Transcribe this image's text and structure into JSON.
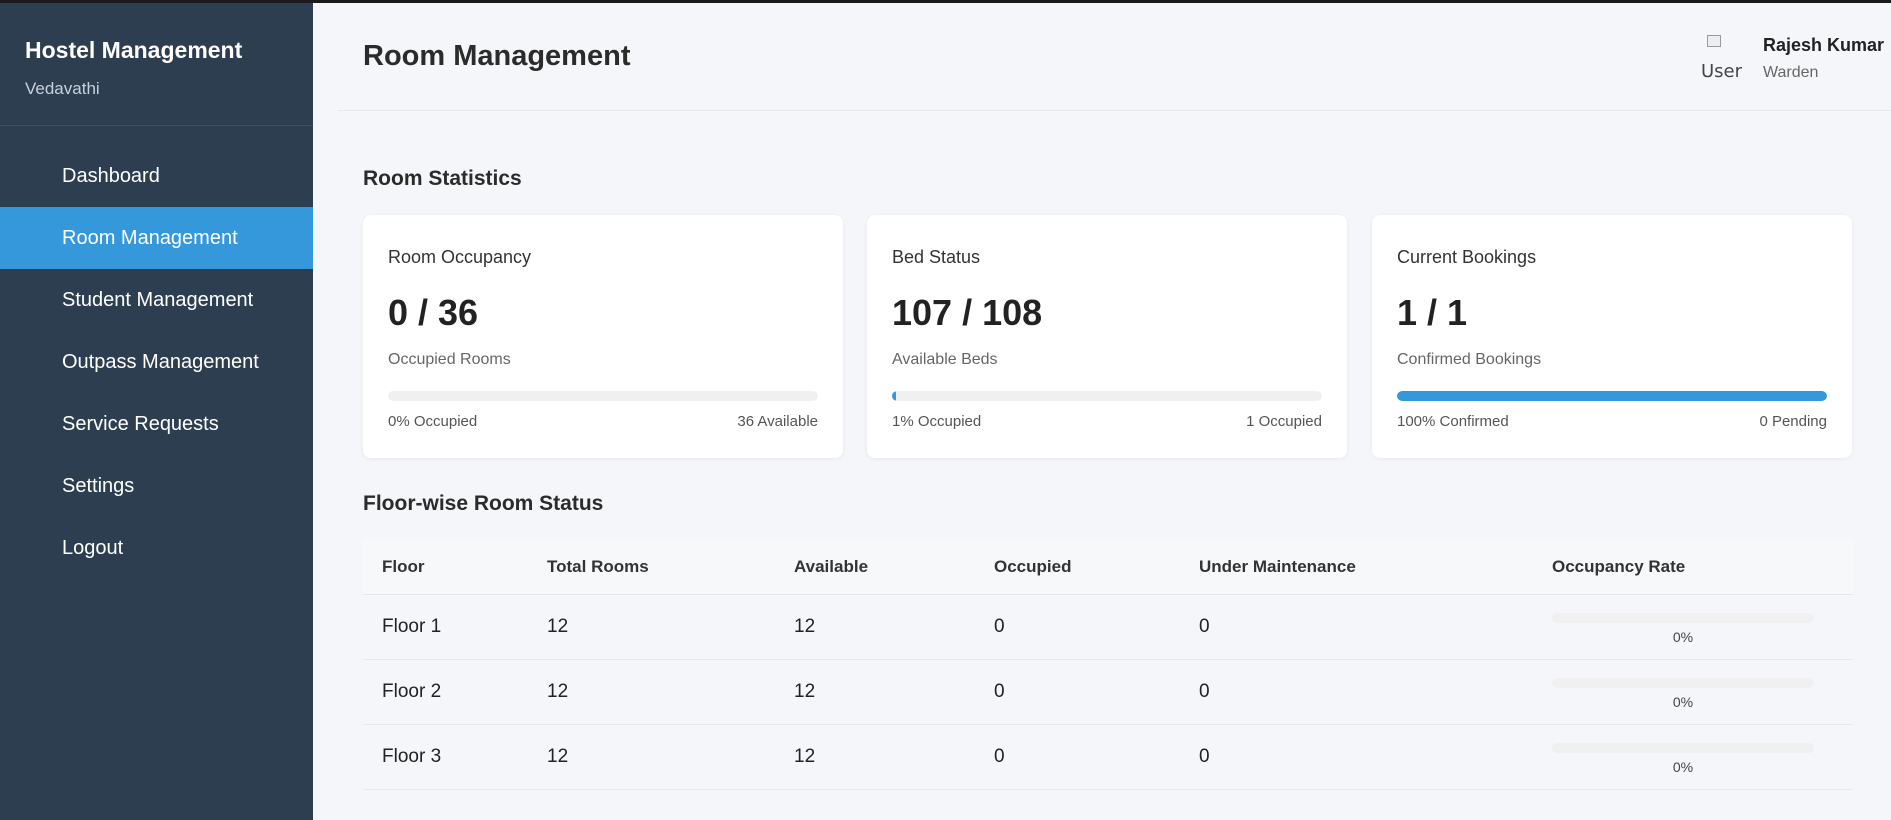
{
  "sidebar": {
    "title": "Hostel Management",
    "subtitle": "Vedavathi",
    "items": [
      {
        "label": "Dashboard",
        "active": false
      },
      {
        "label": "Room Management",
        "active": true
      },
      {
        "label": "Student Management",
        "active": false
      },
      {
        "label": "Outpass Management",
        "active": false
      },
      {
        "label": "Service Requests",
        "active": false
      },
      {
        "label": "Settings",
        "active": false
      },
      {
        "label": "Logout",
        "active": false
      }
    ]
  },
  "header": {
    "title": "Room Management",
    "user": {
      "avatar_alt": "User",
      "name": "Rajesh Kumar",
      "role": "Warden"
    }
  },
  "stats": {
    "section_title": "Room Statistics",
    "cards": [
      {
        "title": "Room Occupancy",
        "value": "0 / 36",
        "sub": "Occupied Rooms",
        "progress": 0,
        "left": "0% Occupied",
        "right": "36 Available"
      },
      {
        "title": "Bed Status",
        "value": "107 / 108",
        "sub": "Available Beds",
        "progress": 1,
        "left": "1% Occupied",
        "right": "1 Occupied"
      },
      {
        "title": "Current Bookings",
        "value": "1 / 1",
        "sub": "Confirmed Bookings",
        "progress": 100,
        "left": "100% Confirmed",
        "right": "0 Pending"
      }
    ]
  },
  "floors": {
    "section_title": "Floor-wise Room Status",
    "columns": [
      "Floor",
      "Total Rooms",
      "Available",
      "Occupied",
      "Under Maintenance",
      "Occupancy Rate"
    ],
    "rows": [
      {
        "floor": "Floor 1",
        "total": "12",
        "available": "12",
        "occupied": "0",
        "maintenance": "0",
        "rate": 0,
        "rate_label": "0%"
      },
      {
        "floor": "Floor 2",
        "total": "12",
        "available": "12",
        "occupied": "0",
        "maintenance": "0",
        "rate": 0,
        "rate_label": "0%"
      },
      {
        "floor": "Floor 3",
        "total": "12",
        "available": "12",
        "occupied": "0",
        "maintenance": "0",
        "rate": 0,
        "rate_label": "0%"
      }
    ]
  },
  "colors": {
    "sidebar": "#2c3e50",
    "accent": "#3498db",
    "background": "#f4f6f9"
  }
}
